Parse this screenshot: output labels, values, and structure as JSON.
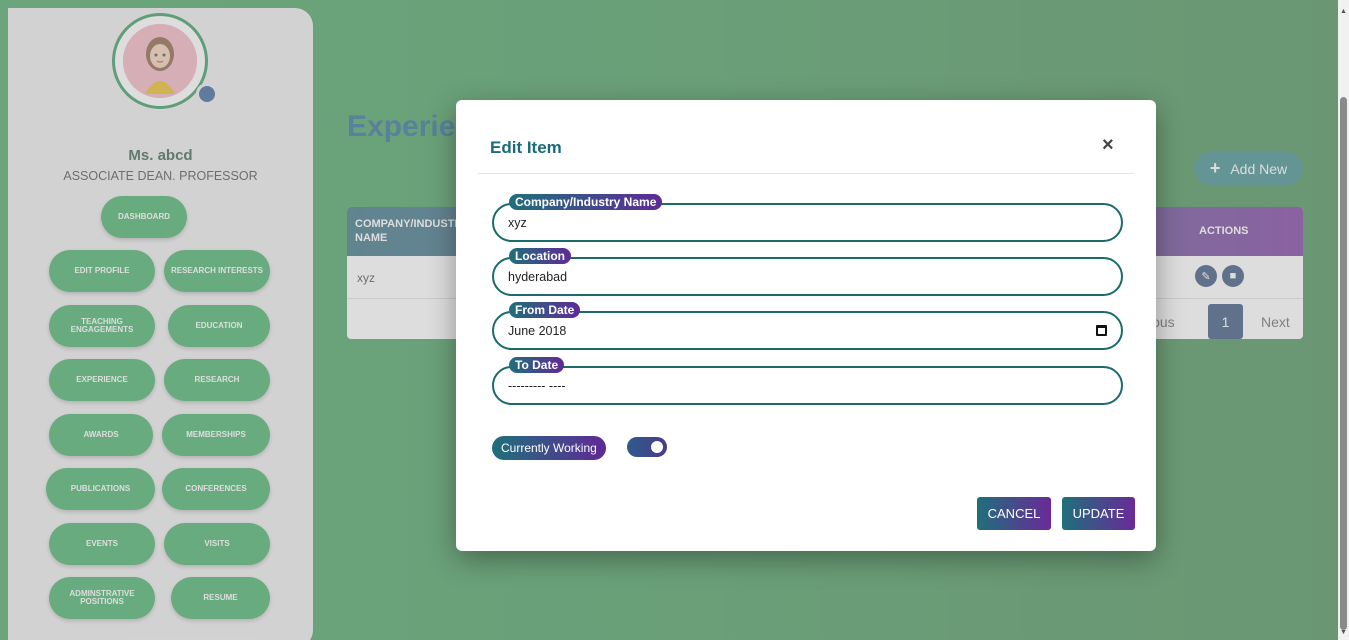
{
  "profile": {
    "name": "Ms. abcd",
    "role": "ASSOCIATE DEAN. PROFESSOR"
  },
  "nav": {
    "dashboard": "DASHBOARD",
    "edit_profile": "EDIT PROFILE",
    "research_interests": "RESEARCH INTERESTS",
    "teaching_engagements": "TEACHING ENGAGEMENTS",
    "education": "EDUCATION",
    "experience": "EXPERIENCE",
    "research": "RESEARCH",
    "awards": "AWARDS",
    "memberships": "MEMBERSHIPS",
    "publications": "PUBLICATIONS",
    "conferences": "CONFERENCES",
    "events": "EVENTS",
    "visits": "VISITS",
    "administrative_positions": "ADMINSTRATIVE POSITIONS",
    "resume": "RESUME"
  },
  "page": {
    "title": "Experienc",
    "add_new_label": "Add New",
    "add_new_icon": "plus-icon"
  },
  "table": {
    "headers": [
      "COMPANY/INDUSTRY NAME",
      "ACTIONS"
    ],
    "rows": [
      {
        "company": "xyz"
      }
    ],
    "actions_icons": [
      "edit-icon",
      "delete-icon"
    ]
  },
  "pagination": {
    "prev_label": "Previous",
    "prev_visible": "vious",
    "page": "1",
    "next_label": "Next"
  },
  "modal": {
    "title": "Edit Item",
    "close_symbol": "×",
    "fields": {
      "company": {
        "label": "Company/Industry Name",
        "value": "xyz"
      },
      "location": {
        "label": "Location",
        "value": "hyderabad"
      },
      "from_date": {
        "label": "From Date",
        "value": "June 2018"
      },
      "to_date": {
        "label": "To Date",
        "value": "--------- ----"
      }
    },
    "currently_working_label": "Currently Working",
    "currently_working": true,
    "cancel_label": "CANCEL",
    "update_label": "UPDATE"
  },
  "colors": {
    "green_primary": "#28a554",
    "title_teal": "#1a6b7a",
    "accent_purple": "#6a2a98",
    "navy": "#1d3d6a"
  }
}
